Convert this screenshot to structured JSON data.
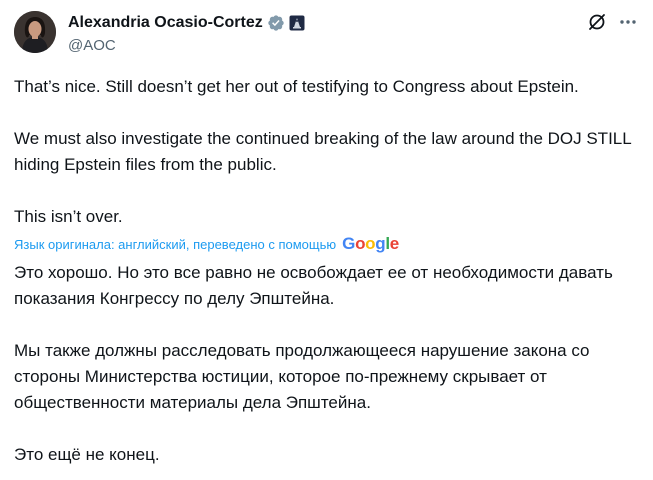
{
  "author": {
    "display_name": "Alexandria Ocasio-Cortez",
    "handle": "@AOC",
    "avatar_icon": "profile-photo",
    "verified_icon": "verified-badge-icon",
    "affiliation_icon": "government-affiliation-icon"
  },
  "actions": {
    "grok_icon": "grok-icon",
    "more_icon": "more-options-icon"
  },
  "tweet": {
    "paragraphs": [
      "That’s nice. Still doesn’t get her out of testifying to Congress about Epstein.",
      "We must also investigate the continued breaking of the law around the DOJ STILL hiding Epstein files from the public.",
      "This isn’t over."
    ]
  },
  "translation": {
    "note": "Язык оригинала: английский, переведено с помощью",
    "provider": "Google",
    "paragraphs": [
      "Это хорошо. Но это все равно не освобождает ее от необходимости давать показания Конгрессу по делу Эпштейна.",
      "Мы также должны расследовать продолжающееся нарушение закона со стороны Министерства юстиции, которое по-прежнему скрывает от общественности материалы дела Эпштейна.",
      "Это ещё не конец."
    ]
  },
  "colors": {
    "text": "#0f1419",
    "secondary": "#536471",
    "link": "#1d9bf0",
    "verified": "#829aab"
  }
}
